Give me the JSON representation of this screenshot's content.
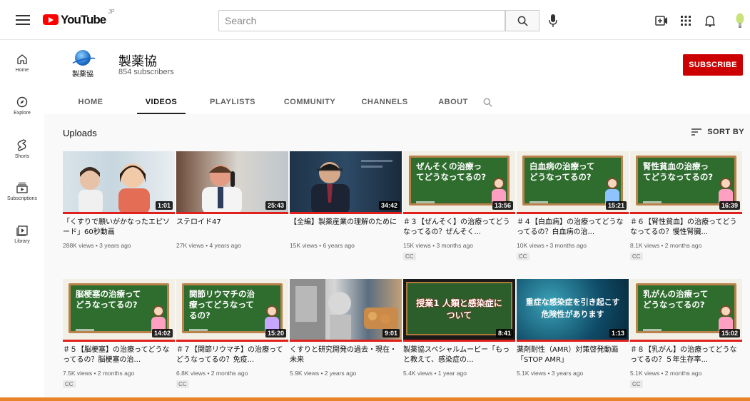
{
  "topbar": {
    "logo_text": "YouTube",
    "logo_region": "JP",
    "search_placeholder": "Search",
    "icons": [
      "menu-icon",
      "search-icon",
      "mic-icon",
      "create-icon",
      "apps-icon",
      "bell-icon",
      "avatar"
    ]
  },
  "sidebar": {
    "items": [
      {
        "label": "Home",
        "icon": "home-icon"
      },
      {
        "label": "Explore",
        "icon": "compass-icon"
      },
      {
        "label": "Shorts",
        "icon": "shorts-icon"
      },
      {
        "label": "Subscriptions",
        "icon": "subscriptions-icon"
      },
      {
        "label": "Library",
        "icon": "library-icon"
      }
    ]
  },
  "channel": {
    "avatar_text": "製薬協",
    "name": "製薬協",
    "subscribers": "854 subscribers",
    "subscribe_label": "SUBSCRIBE",
    "tabs": [
      "HOME",
      "VIDEOS",
      "PLAYLISTS",
      "COMMUNITY",
      "CHANNELS",
      "ABOUT"
    ],
    "active_tab": "VIDEOS"
  },
  "content": {
    "section_title": "Uploads",
    "sort_label": "SORT BY",
    "videos": [
      {
        "title": "「くすりで願いがかなったエピソード」60秒動画",
        "meta": "288K views • 3 years ago",
        "duration": "1:01",
        "cc": "",
        "thumb": "photo-family"
      },
      {
        "title": "ステロイド47",
        "meta": "27K views • 4 years ago",
        "duration": "25:43",
        "cc": "",
        "thumb": "photo-doctor"
      },
      {
        "title": "【全編】製薬産業の理解のために",
        "meta": "15K views • 6 years ago",
        "duration": "34:42",
        "cc": "",
        "thumb": "photo-speaker"
      },
      {
        "title": "＃３【ぜんそく】の治療ってどうなってるの？ぜんそく...",
        "meta": "15K views • 3 months ago",
        "duration": "13:56",
        "cc": "CC",
        "thumb": "board",
        "board_text": "ぜんそくの治療ってどうなってるの?"
      },
      {
        "title": "＃４【白血病】の治療ってどうなってるの？白血病の治...",
        "meta": "10K views • 3 months ago",
        "duration": "15:21",
        "cc": "CC",
        "thumb": "board",
        "board_text": "白血病の治療ってどうなってるの?"
      },
      {
        "title": "＃６【腎性貧血】の治療ってどうなってるの？慢性腎臓...",
        "meta": "8.1K views • 2 months ago",
        "duration": "16:39",
        "cc": "CC",
        "thumb": "board",
        "board_text": "腎性貧血の治療ってどうなってるの?"
      },
      {
        "title": "＃５【脳梗塞】の治療ってどうなってるの？脳梗塞の治...",
        "meta": "7.5K views • 2 months ago",
        "duration": "14:02",
        "cc": "CC",
        "thumb": "board",
        "board_text": "脳梗塞の治療ってどうなってるの?"
      },
      {
        "title": "＃７【関節リウマチ】の治療ってどうなってるの？免疫...",
        "meta": "6.8K views • 2 months ago",
        "duration": "15:20",
        "cc": "CC",
        "thumb": "board",
        "board_text": "関節リウマチの治療ってどうなってるの?"
      },
      {
        "title": "くすりと研究開発の過去・現在・未来",
        "meta": "5.9K views • 2 years ago",
        "duration": "9:01",
        "cc": "",
        "thumb": "photo-history"
      },
      {
        "title": "製薬協スペシャルムービー「もっと教えて、感染症の...",
        "meta": "5.4K views • 1 year ago",
        "duration": "8:41",
        "cc": "",
        "thumb": "photo-class",
        "board_text": "授業1 人類と感染症について"
      },
      {
        "title": "薬剤耐性（AMR）対策啓発動画「STOP AMR」",
        "meta": "5.1K views • 3 years ago",
        "duration": "1:13",
        "cc": "",
        "thumb": "photo-amr",
        "board_text": "重症な感染症を引き起こす危険性があります"
      },
      {
        "title": "＃８【乳がん】の治療ってどうなってるの？５年生存率...",
        "meta": "5.1K views • 2 months ago",
        "duration": "15:02",
        "cc": "CC",
        "thumb": "board",
        "board_text": "乳がんの治療ってどうなってるの?"
      }
    ]
  }
}
